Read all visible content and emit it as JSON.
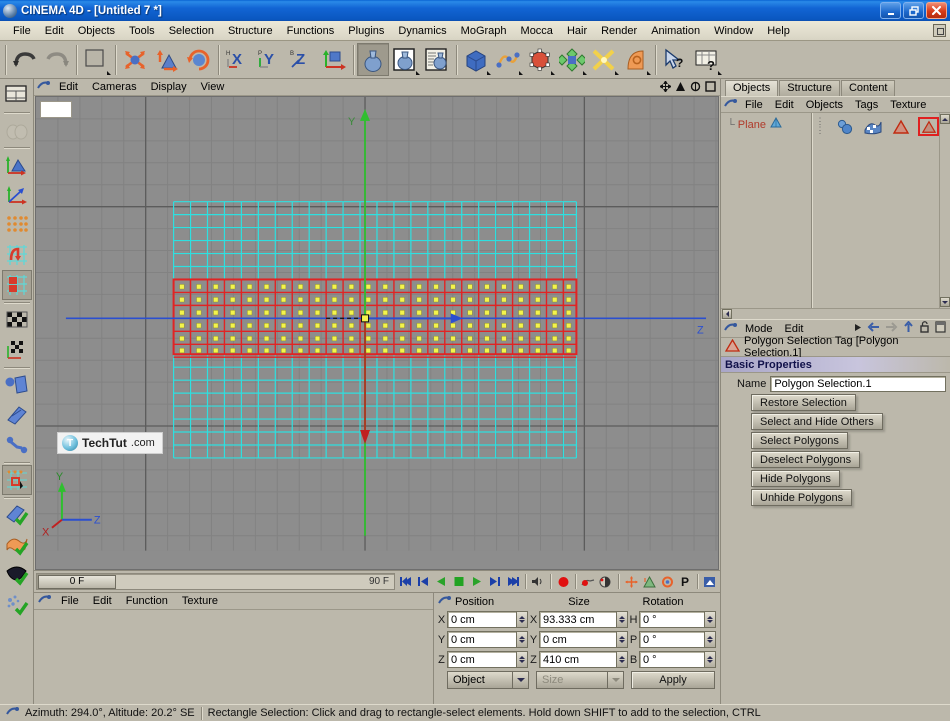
{
  "window": {
    "title": "CINEMA 4D - [Untitled 7 *]",
    "minimize": "_",
    "restore": "❐",
    "close": "✕"
  },
  "menubar": {
    "items": [
      "File",
      "Edit",
      "Objects",
      "Tools",
      "Selection",
      "Structure",
      "Functions",
      "Plugins",
      "Dynamics",
      "MoGraph",
      "Mocca",
      "Hair",
      "Render",
      "Animation",
      "Window",
      "Help"
    ]
  },
  "toolbar": {
    "icons": [
      {
        "name": "undo-icon",
        "label": "Undo"
      },
      {
        "name": "redo-icon",
        "label": "Redo"
      },
      {
        "name": "live-selection-icon",
        "label": "Live Selection"
      },
      {
        "name": "move-tool-icon",
        "label": "Move"
      },
      {
        "name": "scale-tool-icon",
        "label": "Scale"
      },
      {
        "name": "rotate-tool-icon",
        "label": "Rotate"
      },
      {
        "name": "x-axis-lock-icon",
        "label": "X Axis"
      },
      {
        "name": "y-axis-lock-icon",
        "label": "Y Axis"
      },
      {
        "name": "z-axis-lock-icon",
        "label": "Z Axis"
      },
      {
        "name": "world-object-coordinate-icon",
        "label": "World/Object"
      },
      {
        "name": "render-view-icon",
        "label": "Render View"
      },
      {
        "name": "render-region-icon",
        "label": "Render Region"
      },
      {
        "name": "render-settings-icon",
        "label": "Render Settings"
      },
      {
        "name": "add-cube-object-icon",
        "label": "Cube"
      },
      {
        "name": "add-spline-icon",
        "label": "Spline"
      },
      {
        "name": "add-hyper-nurbs-icon",
        "label": "HyperNURBS"
      },
      {
        "name": "add-array-icon",
        "label": "Array"
      },
      {
        "name": "add-deformer-icon",
        "label": "Deformer"
      },
      {
        "name": "add-scene-object-icon",
        "label": "Scene"
      },
      {
        "name": "help-cursor-icon",
        "label": "Help"
      },
      {
        "name": "structure-help-icon",
        "label": "Structure Help"
      }
    ]
  },
  "leftbar": {
    "icons": [
      {
        "name": "layout-mode-icon",
        "label": "Layout"
      },
      {
        "name": "make-editable-icon",
        "label": "Make Editable"
      },
      {
        "name": "model-mode-icon",
        "label": "Model Mode"
      },
      {
        "name": "object-axis-mode-icon",
        "label": "Object Axis Mode"
      },
      {
        "name": "point-mode-icon",
        "label": "Points"
      },
      {
        "name": "edge-mode-icon",
        "label": "Edges"
      },
      {
        "name": "polygon-mode-icon",
        "label": "Polygons",
        "selected": true
      },
      {
        "name": "texture-mode-icon",
        "label": "Texture"
      },
      {
        "name": "texture-axis-mode-icon",
        "label": "Texture Axis"
      },
      {
        "name": "animation-mode-icon",
        "label": "Animation"
      },
      {
        "name": "enable-axis-icon",
        "label": "Enable Axis Modification"
      },
      {
        "name": "viewport-solo-icon",
        "label": "Viewport Solo"
      },
      {
        "name": "uv-points-mode-icon",
        "label": "UV Points",
        "selected": true
      },
      {
        "name": "use-quantize-icon",
        "label": "Quantize"
      },
      {
        "name": "use-deformed-icon",
        "label": "Deformed Editing"
      },
      {
        "name": "use-isoline-icon",
        "label": "Isoline Editing"
      },
      {
        "name": "viewport-filter-icon",
        "label": "Viewport Filter"
      }
    ]
  },
  "viewport": {
    "menu": [
      "Edit",
      "Cameras",
      "Display",
      "View"
    ],
    "corner_controls": [
      {
        "name": "viewport-pan-icon",
        "label": "Move Camera"
      },
      {
        "name": "viewport-zoom-icon",
        "label": "Scale Camera"
      },
      {
        "name": "viewport-rotate-icon",
        "label": "Rotate Camera"
      },
      {
        "name": "viewport-maximize-icon",
        "label": "Maximize View"
      }
    ],
    "axis_labels": {
      "y": "Y",
      "z": "Z",
      "x": "X"
    },
    "gizmo": {
      "y": "Y",
      "z": "Z",
      "x": "X"
    },
    "watermark": {
      "logo": "T",
      "text": "TechTut",
      "suffix": ".com"
    }
  },
  "timeline": {
    "current_frame": "0 F",
    "end_frame": "90 F",
    "transport": [
      {
        "name": "go-to-start-icon",
        "label": "Go to Start"
      },
      {
        "name": "step-back-icon",
        "label": "Previous Frame"
      },
      {
        "name": "play-reverse-icon",
        "label": "Play Reverse"
      },
      {
        "name": "stop-icon",
        "label": "Stop"
      },
      {
        "name": "play-forward-icon",
        "label": "Play Forward"
      },
      {
        "name": "step-forward-icon",
        "label": "Next Frame"
      },
      {
        "name": "go-to-end-icon",
        "label": "Go to End"
      },
      {
        "name": "sound-icon",
        "label": "Sound"
      },
      {
        "name": "record-icon",
        "label": "Record Active Objects"
      },
      {
        "name": "autokey-icon",
        "label": "Autokeying"
      },
      {
        "name": "keyframe-selection-icon",
        "label": "Keyframe Selection"
      },
      {
        "name": "record-position-icon",
        "label": "Position"
      },
      {
        "name": "record-scale-icon",
        "label": "Scale"
      },
      {
        "name": "record-rotation-icon",
        "label": "Rotation"
      },
      {
        "name": "record-parameter-icon",
        "label": "P"
      },
      {
        "name": "record-pla-icon",
        "label": "PLA"
      }
    ]
  },
  "material_panel": {
    "menu": [
      "File",
      "Edit",
      "Function",
      "Texture"
    ]
  },
  "coordinates": {
    "headers": {
      "position": "Position",
      "size": "Size",
      "rotation": "Rotation"
    },
    "rows": [
      {
        "pos_label": "X",
        "pos_value": "0 cm",
        "size_label": "X",
        "size_value": "93.333 cm",
        "rot_label": "H",
        "rot_value": "0 °"
      },
      {
        "pos_label": "Y",
        "pos_value": "0 cm",
        "size_label": "Y",
        "size_value": "0 cm",
        "rot_label": "P",
        "rot_value": "0 °"
      },
      {
        "pos_label": "Z",
        "pos_value": "0 cm",
        "size_label": "Z",
        "size_value": "410 cm",
        "rot_label": "B",
        "rot_value": "0 °"
      }
    ],
    "coord_system": "Object",
    "size_mode": "Size",
    "apply": "Apply"
  },
  "object_manager": {
    "tabs": [
      {
        "label": "Objects",
        "active": true
      },
      {
        "label": "Structure",
        "active": false
      },
      {
        "label": "Content",
        "active": false
      }
    ],
    "menu": [
      "File",
      "Edit",
      "Objects",
      "Tags",
      "Texture"
    ],
    "objects": [
      {
        "name": "Plane",
        "icon": "plane-object-icon"
      }
    ],
    "tags": [
      {
        "name": "material-tag-icon",
        "label": "Material Tag"
      },
      {
        "name": "texture-tag-icon",
        "label": "Texture Tag"
      },
      {
        "name": "polygon-selection-tag-icon",
        "label": "Polygon Selection",
        "selected": false
      },
      {
        "name": "polygon-selection-tag-icon-2",
        "label": "Polygon Selection.1",
        "selected": true
      }
    ]
  },
  "attribute_manager": {
    "toolbar": [
      "Mode",
      "Edit"
    ],
    "toolbar_icons": [
      {
        "name": "history-forward-icon",
        "label": "Forward"
      },
      {
        "name": "history-back-icon",
        "label": "Back"
      },
      {
        "name": "history-next-icon",
        "label": "Next"
      },
      {
        "name": "go-up-icon",
        "label": "Up"
      },
      {
        "name": "lock-icon",
        "label": "Lock"
      },
      {
        "name": "new-window-icon",
        "label": "New Window"
      }
    ],
    "title": "Polygon Selection Tag [Polygon Selection.1]",
    "section": "Basic Properties",
    "name_label": "Name",
    "name_value": "Polygon Selection.1",
    "buttons": [
      "Restore Selection",
      "Select and Hide Others",
      "Select Polygons",
      "Deselect Polygons",
      "Hide Polygons",
      "Unhide Polygons"
    ]
  },
  "statusbar": {
    "camera": "Azimuth: 294.0°, Altitude: 20.2° SE",
    "hint": "Rectangle Selection: Click and drag to rectangle-select elements. Hold down SHIFT to add to the selection, CTRL"
  },
  "colors": {
    "titlebar": "#1265d4",
    "chrome": "#bcb8ab",
    "viewport_bg": "#8d8d8d",
    "wireframe": "#34e0e0",
    "selection": "#e02424",
    "selected_point": "#f2f24a",
    "axis_y": "#1fbf1f",
    "axis_x": "#d02020",
    "axis_z": "#2b4fd0",
    "section_header": "#a9a6c8"
  }
}
